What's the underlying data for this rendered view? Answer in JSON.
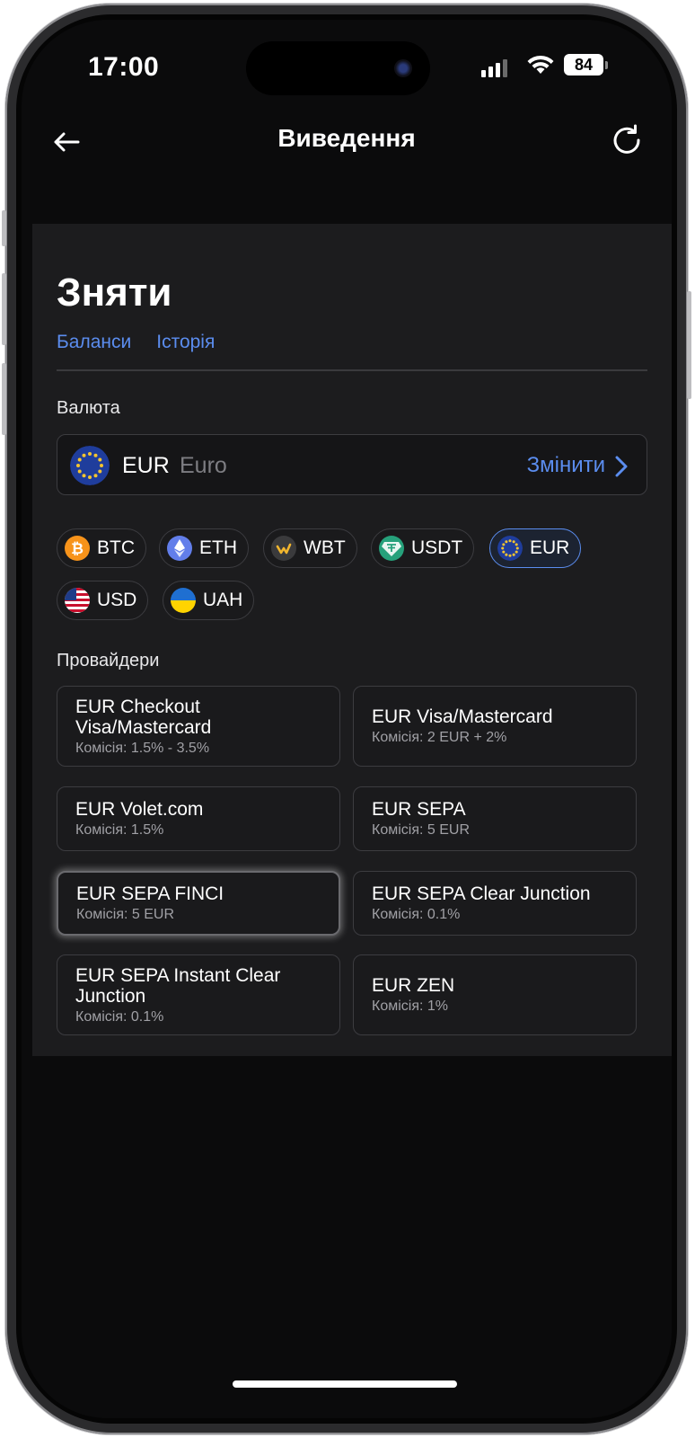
{
  "status": {
    "time": "17:00",
    "battery": "84"
  },
  "nav": {
    "title": "Виведення",
    "back_icon": "arrow-left-icon",
    "refresh_icon": "refresh-icon"
  },
  "page": {
    "heading": "Зняти",
    "tabs": [
      {
        "label": "Баланси"
      },
      {
        "label": "Історія"
      }
    ]
  },
  "currency": {
    "section_label": "Валюта",
    "selected_code": "EUR",
    "selected_name": "Euro",
    "change_label": "Змінити",
    "chips": [
      {
        "code": "BTC",
        "icon": "bitcoin-icon"
      },
      {
        "code": "ETH",
        "icon": "ethereum-icon"
      },
      {
        "code": "WBT",
        "icon": "whitebit-icon"
      },
      {
        "code": "USDT",
        "icon": "tether-icon"
      },
      {
        "code": "EUR",
        "icon": "eu-flag-icon",
        "active": true
      },
      {
        "code": "USD",
        "icon": "us-flag-icon"
      },
      {
        "code": "UAH",
        "icon": "ua-flag-icon"
      }
    ]
  },
  "providers": {
    "section_label": "Провайдери",
    "items": [
      {
        "name": "EUR Checkout Visa/Mastercard",
        "fee": "Комісія: 1.5% - 3.5%"
      },
      {
        "name": "EUR Visa/Mastercard",
        "fee": "Комісія: 2 EUR + 2%"
      },
      {
        "name": "EUR Volet.com",
        "fee": "Комісія: 1.5%"
      },
      {
        "name": "EUR SEPA",
        "fee": "Комісія: 5 EUR"
      },
      {
        "name": "EUR SEPA FINCI",
        "fee": "Комісія: 5 EUR"
      },
      {
        "name": "EUR SEPA Clear Junction",
        "fee": "Комісія: 0.1%"
      },
      {
        "name": "EUR SEPA Instant Clear Junction",
        "fee": "Комісія: 0.1%"
      },
      {
        "name": "EUR ZEN",
        "fee": "Комісія: 1%"
      }
    ]
  },
  "colors": {
    "accent": "#5b8def",
    "background": "#0b0b0c",
    "panel": "#1c1c1e"
  }
}
